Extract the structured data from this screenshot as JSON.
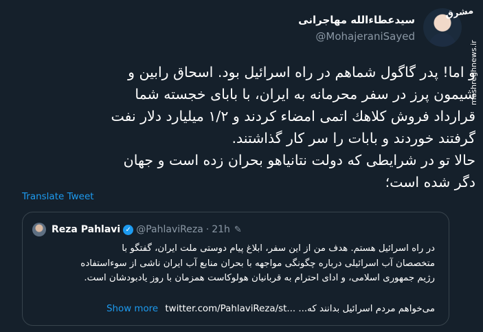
{
  "author": {
    "name": "سیدعطاءالله مهاجرانی",
    "handle": "@MohajeraniSayed"
  },
  "tweet": {
    "text_lines": [
      "و اما! پدر گاگول شماهم در راه اسرائیل بود. اسحاق رابین و",
      "شیمون پرز در سفر محرمانه به ایران، با بابای خجسته شما",
      "قرارداد فروش کلاهك اتمی امضاء کردند و ۱/۲ میلیارد دلار نفت",
      "گرفتند خوردند و بابات را سر کار گذاشتند.",
      "حالا تو در شرایطی که دولت نتانیاهو بحران زده است و جهان",
      "دگر شده است؛"
    ],
    "translate_label": "Translate Tweet"
  },
  "quoted": {
    "name": "Reza Pahlavi",
    "handle": "@PahlaviReza",
    "dot": "·",
    "time": "21h",
    "text_lines": [
      "در راه اسرائیل هستم. هدف من از این سفر، ابلاغ پیام دوستی ملت ایران، گفتگو با",
      "متخصصان آب اسرائیلی درباره چگونگی مواجهه با بحران منابع آب ایران ناشی از سوءاستفاده",
      "رژیم جمهوری اسلامی، و ادای احترام به قربانیان هولوکاست همزمان با روز یادبودشان است."
    ],
    "last_line": "می‌خواهم مردم اسرائیل بدانند که...",
    "link": "twitter.com/PahlaviReza/st...",
    "show_more": "Show more"
  },
  "watermark": {
    "logo": "مشرق",
    "text": "mashreghnews.ir"
  }
}
